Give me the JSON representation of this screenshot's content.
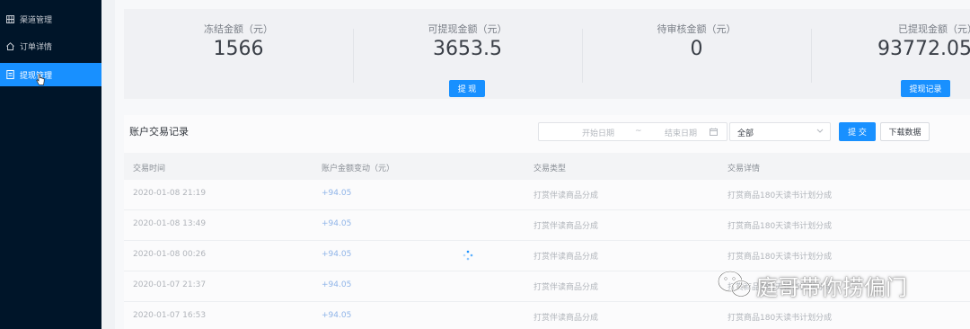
{
  "sidebar": {
    "items": [
      {
        "label": "渠道管理",
        "icon": "grid-icon"
      },
      {
        "label": "订单详情",
        "icon": "home-icon"
      },
      {
        "label": "提现管理",
        "icon": "document-icon"
      }
    ]
  },
  "stats": [
    {
      "label": "冻结金额（元）",
      "value": "1566"
    },
    {
      "label": "可提现金额（元）",
      "value": "3653.5",
      "button": "提 现"
    },
    {
      "label": "待审核金额（元）",
      "value": "0"
    },
    {
      "label": "已提现金额（元）",
      "value": "93772.05",
      "button": "提现记录"
    }
  ],
  "transactions": {
    "title": "账户交易记录",
    "start_date_placeholder": "开始日期",
    "date_separator": "~",
    "end_date_placeholder": "结束日期",
    "select_value": "全部",
    "submit_label": "提 交",
    "download_label": "下载数据",
    "columns": [
      "交易时间",
      "账户金额变动（元）",
      "交易类型",
      "交易详情"
    ],
    "rows": [
      [
        "2020-01-08 21:19",
        "+94.05",
        "打赏伴读商品分成",
        "打赏商品180天读书计划分成"
      ],
      [
        "2020-01-08 13:49",
        "+94.05",
        "打赏伴读商品分成",
        "打赏商品180天读书计划分成"
      ],
      [
        "2020-01-08 00:26",
        "+94.05",
        "打赏伴读商品分成",
        "打赏商品180天读书计划分成"
      ],
      [
        "2020-01-07 21:37",
        "+94.05",
        "打赏伴读商品分成",
        "打赏商品180天读书计划分成"
      ],
      [
        "2020-01-07 16:53",
        "+94.05",
        "打赏伴读商品分成",
        "打赏商品180天读书计划分成"
      ]
    ]
  },
  "watermark": "庭哥带你捞偏门",
  "colors": {
    "sidebar_bg": "#001529",
    "accent": "#1890ff"
  }
}
